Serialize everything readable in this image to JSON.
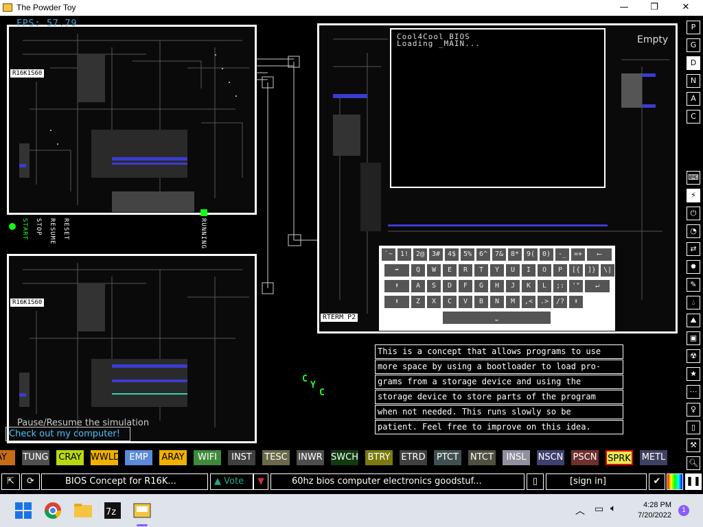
{
  "window": {
    "title": "The Powder Toy",
    "minimize": "—",
    "maximize": "❐",
    "close": "✕"
  },
  "overlay": {
    "fps": "FPS: 57.79",
    "tooltip": "Pause/Resume the simulation",
    "intro_button": "Check out my computer!",
    "empty_label": "Empty",
    "cyc_label": "C\n Y\n  C"
  },
  "boards": [
    {
      "label": "R16K1S60"
    },
    {
      "label": "R16K1S60"
    }
  ],
  "control_labels": {
    "start": "START",
    "stop": "STOP",
    "resume": "RESUME",
    "reset": "RESET",
    "running": "RUNNING"
  },
  "terminal": {
    "label": "RTERM P2",
    "line1": "Cool4Cool BIOS",
    "line2": "Loading _MAIN..."
  },
  "keyboard": {
    "row1": [
      "`~",
      "1!",
      "2@",
      "3#",
      "4$",
      "5%",
      "6^",
      "7&",
      "8*",
      "9(",
      "0)",
      "-_",
      "=+",
      "⟵"
    ],
    "row2": [
      "➡",
      "Q",
      "W",
      "E",
      "R",
      "T",
      "Y",
      "U",
      "I",
      "O",
      "P",
      "[{",
      "]}",
      "\\|"
    ],
    "row3": [
      "⬆",
      "A",
      "S",
      "D",
      "F",
      "G",
      "H",
      "J",
      "K",
      "L",
      ";:",
      "'\"",
      "↵"
    ],
    "row4": [
      "⬆",
      "Z",
      "X",
      "C",
      "V",
      "B",
      "N",
      "M",
      ",<",
      ".>",
      "/?",
      "⬆"
    ],
    "space": "⎵"
  },
  "description": [
    "This is a concept that allows programs to use",
    "more space by using a bootloader to load pro-",
    "grams from a storage device and using the",
    "storage device to store parts of the program",
    "when not needed. This runs slowly so be",
    "patient. Feel free to improve on this idea."
  ],
  "right_toolbar_top": [
    "P",
    "G",
    "D",
    "N",
    "A",
    "C"
  ],
  "right_toolbar_icons": [
    "keyboard-icon",
    "plug-icon",
    "power-icon",
    "sensor-icon",
    "arrows-icon",
    "explosive-icon",
    "pen-icon",
    "liquid-icon",
    "gas-icon",
    "solid-icon",
    "radioactive-icon",
    "star-icon",
    "dots-icon",
    "life-icon",
    "bookmark-icon",
    "tools-icon",
    "search-icon"
  ],
  "elements": [
    {
      "name": "AY",
      "bg": "#c76d16",
      "fg": "#000"
    },
    {
      "name": "TUNG",
      "bg": "#505050",
      "fg": "#fff"
    },
    {
      "name": "CRAY",
      "bg": "#b8d810",
      "fg": "#000"
    },
    {
      "name": "WWLD",
      "bg": "#f0b000",
      "fg": "#000"
    },
    {
      "name": "EMP",
      "bg": "#5c8ad8",
      "fg": "#fff"
    },
    {
      "name": "ARAY",
      "bg": "#f0b000",
      "fg": "#000"
    },
    {
      "name": "WIFI",
      "bg": "#3f8a3a",
      "fg": "#fff"
    },
    {
      "name": "INST",
      "bg": "#404040",
      "fg": "#fff"
    },
    {
      "name": "TESC",
      "bg": "#6a6a4a",
      "fg": "#fff"
    },
    {
      "name": "INWR",
      "bg": "#4e4e4e",
      "fg": "#fff"
    },
    {
      "name": "SWCH",
      "bg": "#0f3b0f",
      "fg": "#fff"
    },
    {
      "name": "BTRY",
      "bg": "#7a7a10",
      "fg": "#fff"
    },
    {
      "name": "ETRD",
      "bg": "#404040",
      "fg": "#fff"
    },
    {
      "name": "PTCT",
      "bg": "#405050",
      "fg": "#fff"
    },
    {
      "name": "NTCT",
      "bg": "#505040",
      "fg": "#fff"
    },
    {
      "name": "INSL",
      "bg": "#9090a0",
      "fg": "#fff"
    },
    {
      "name": "NSCN",
      "bg": "#404070",
      "fg": "#fff"
    },
    {
      "name": "PSCN",
      "bg": "#703030",
      "fg": "#fff"
    },
    {
      "name": "SPRK",
      "bg": "#e8e850",
      "fg": "#000",
      "selected": true
    },
    {
      "name": "METL",
      "bg": "#404060",
      "fg": "#fff"
    }
  ],
  "bottom_bar": {
    "save_title": "BIOS Concept for R16K...",
    "vote": "Vote",
    "tags": "60hz bios computer electronics goodstuf...",
    "sign_in": "[sign in]"
  },
  "taskbar": {
    "time": "4:28 PM",
    "date": "7/20/2022",
    "notifications": "1",
    "apps": [
      "start-icon",
      "chrome-icon",
      "file-explorer-icon",
      "7zip-icon",
      "powder-toy-icon"
    ]
  }
}
